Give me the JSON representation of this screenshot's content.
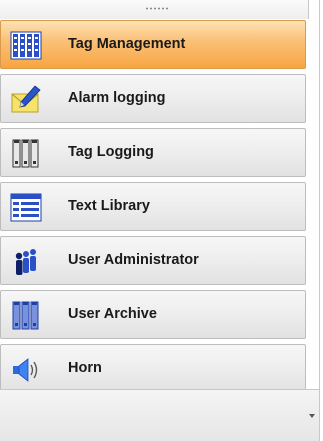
{
  "navigation": {
    "items": [
      {
        "label": "Tag Management",
        "icon": "tag-management-icon",
        "active": true
      },
      {
        "label": "Alarm logging",
        "icon": "alarm-logging-icon",
        "active": false
      },
      {
        "label": "Tag Logging",
        "icon": "tag-logging-icon",
        "active": false
      },
      {
        "label": "Text Library",
        "icon": "text-library-icon",
        "active": false
      },
      {
        "label": "User Administrator",
        "icon": "user-administrator-icon",
        "active": false
      },
      {
        "label": "User Archive",
        "icon": "user-archive-icon",
        "active": false
      },
      {
        "label": "Horn",
        "icon": "horn-icon",
        "active": false
      }
    ]
  },
  "footer": {
    "overflow_icon": "chevron-down-icon"
  },
  "colors": {
    "active_item": "#f8a542",
    "item_background": "#ececec",
    "border": "#bdbdbd",
    "text": "#1a1a1a"
  }
}
